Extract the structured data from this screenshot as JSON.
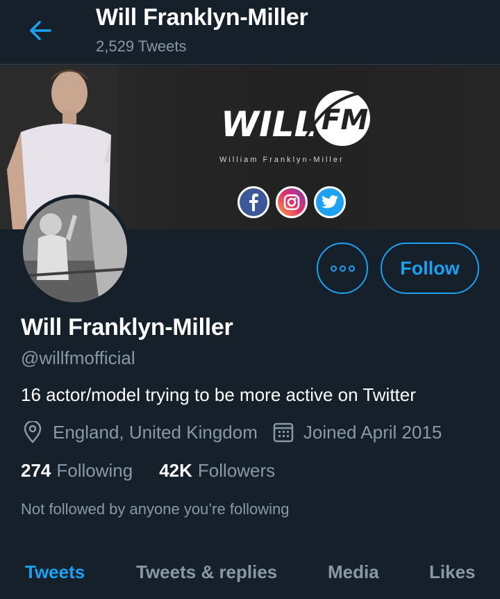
{
  "header": {
    "title": "Will Franklyn-Miller",
    "tweet_count": "2,529 Tweets",
    "back_icon": "arrow-left-icon"
  },
  "banner": {
    "logo_text": "WILL FM",
    "tagline": "William Franklyn-Miller",
    "social_icons": [
      "facebook-icon",
      "instagram-icon",
      "twitter-icon"
    ]
  },
  "profile": {
    "name": "Will Franklyn-Miller",
    "handle": "@willfmofficial",
    "bio": "16 actor/model trying to be more active on Twitter",
    "location": "England, United Kingdom",
    "joined": "Joined April 2015",
    "following_count": "274",
    "following_label": "Following",
    "followers_count": "42K",
    "followers_label": "Followers",
    "not_followed_note": "Not followed by anyone you’re following"
  },
  "actions": {
    "follow_label": "Follow",
    "more_icon": "more-options-icon"
  },
  "tabs": [
    {
      "label": "Tweets",
      "active": true
    },
    {
      "label": "Tweets & replies",
      "active": false
    },
    {
      "label": "Media",
      "active": false
    },
    {
      "label": "Likes",
      "active": false
    }
  ],
  "colors": {
    "background": "#15202b",
    "accent": "#1da1f2",
    "secondary_text": "#8899a6",
    "divider": "#38444d"
  }
}
